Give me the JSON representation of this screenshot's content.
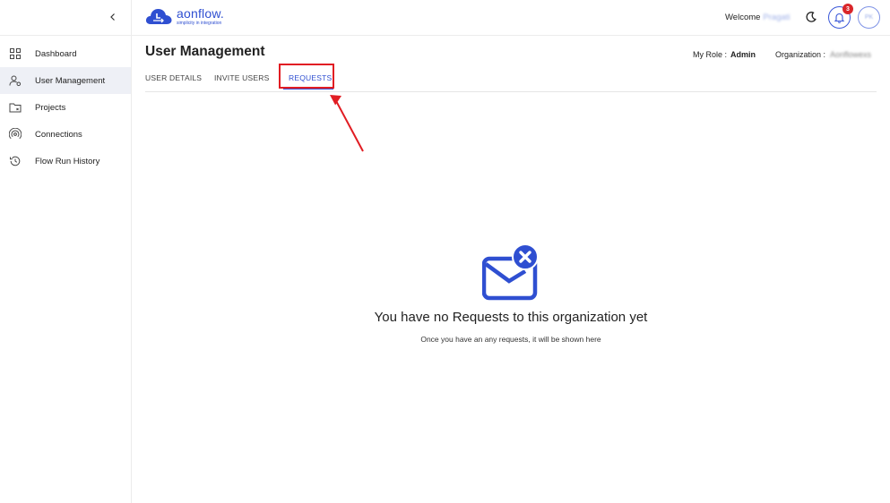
{
  "brand": {
    "name": "aonflow.",
    "tagline": "simplicity in integration",
    "color": "#2f4fd1"
  },
  "sidebar": {
    "items": [
      {
        "label": "Dashboard",
        "icon": "grid-icon"
      },
      {
        "label": "User Management",
        "icon": "users-gear-icon",
        "active": true
      },
      {
        "label": "Projects",
        "icon": "folder-icon"
      },
      {
        "label": "Connections",
        "icon": "broadcast-icon"
      },
      {
        "label": "Flow Run History",
        "icon": "history-icon"
      }
    ]
  },
  "header": {
    "welcome_label": "Welcome",
    "welcome_name": "Pragati",
    "notifications_count": "3",
    "avatar_initials": "PK"
  },
  "page": {
    "title": "User Management",
    "role_label": "My Role :",
    "role_value": "Admin",
    "org_label": "Organization :",
    "org_value": "Aonflowexs"
  },
  "tabs": [
    {
      "label": "USER DETAILS"
    },
    {
      "label": "INVITE USERS"
    },
    {
      "label": "REQUESTS",
      "active": true
    }
  ],
  "empty_state": {
    "icon": "mail-x-icon",
    "title": "You have no Requests to this organization yet",
    "subtitle": "Once you have an any requests, it will be shown here"
  },
  "annotation": {
    "highlight_color": "#e11d23"
  }
}
